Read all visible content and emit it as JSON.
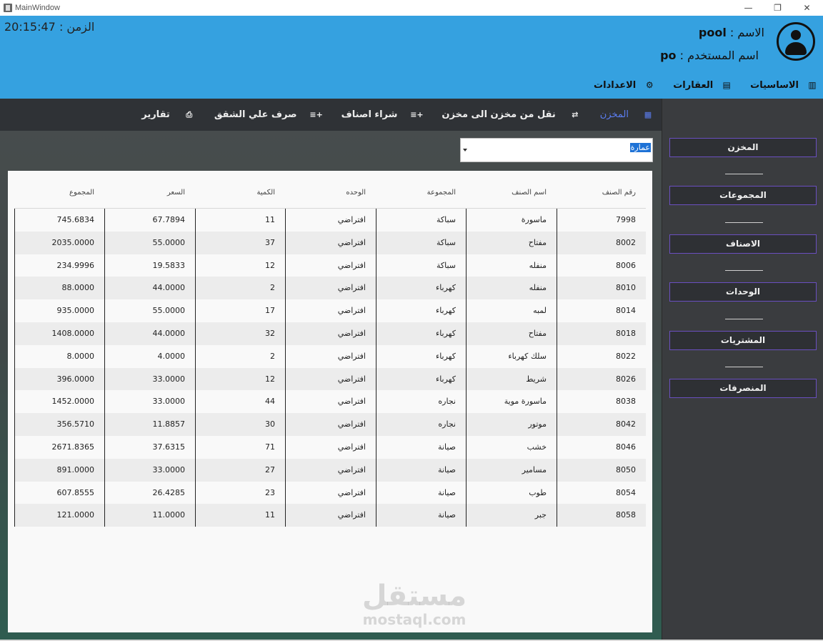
{
  "window": {
    "title": "MainWindow",
    "minimize": "—",
    "restore": "❐",
    "close": "✕"
  },
  "header": {
    "clock": "الزمن : 20:15:47",
    "name_label": "الاسم :",
    "name_value": "pool",
    "login_label": "اسم المستخدم :",
    "login_value": "po"
  },
  "menu": [
    {
      "label": "الاساسيات",
      "icon": "office-building-icon"
    },
    {
      "label": "العقارات",
      "icon": "notebook-icon"
    },
    {
      "label": "الاعدادات",
      "icon": "gear-icon"
    }
  ],
  "toolbar": [
    {
      "label": "المخزن",
      "icon": "calendar-icon",
      "active": true
    },
    {
      "label": "نقل من مخزن الى مخزن",
      "icon": "swap-arrows-icon"
    },
    {
      "label": "شراء اصناف",
      "icon": "add-list-icon"
    },
    {
      "label": "صرف علي الشقق",
      "icon": "add-list-icon"
    },
    {
      "label": "تقارير",
      "icon": "printer-icon"
    }
  ],
  "combo": {
    "value": "عمارة"
  },
  "table": {
    "headers": [
      "رقم الصنف",
      "اسم الصنف",
      "المجموعة",
      "الوحده",
      "الكمية",
      "السعر",
      "المجموع"
    ],
    "rows": [
      [
        "7998",
        "ماسورة",
        "سباكة",
        "افتراضي",
        "11",
        "67.7894",
        "745.6834"
      ],
      [
        "8002",
        "مفتاح",
        "سباكة",
        "افتراضي",
        "37",
        "55.0000",
        "2035.0000"
      ],
      [
        "8006",
        "منفله",
        "سباكة",
        "افتراضي",
        "12",
        "19.5833",
        "234.9996"
      ],
      [
        "8010",
        "منفله",
        "كهرباء",
        "افتراضي",
        "2",
        "44.0000",
        "88.0000"
      ],
      [
        "8014",
        "لمبه",
        "كهرباء",
        "افتراضي",
        "17",
        "55.0000",
        "935.0000"
      ],
      [
        "8018",
        "مفتاح",
        "كهرباء",
        "افتراضي",
        "32",
        "44.0000",
        "1408.0000"
      ],
      [
        "8022",
        "سلك كهرباء",
        "كهرباء",
        "افتراضي",
        "2",
        "4.0000",
        "8.0000"
      ],
      [
        "8026",
        "شريط",
        "كهرباء",
        "افتراضي",
        "12",
        "33.0000",
        "396.0000"
      ],
      [
        "8038",
        "ماسورة موية",
        "نجاره",
        "افتراضي",
        "44",
        "33.0000",
        "1452.0000"
      ],
      [
        "8042",
        "موتور",
        "نجاره",
        "افتراضي",
        "30",
        "11.8857",
        "356.5710"
      ],
      [
        "8046",
        "خشب",
        "صيانة",
        "افتراضي",
        "71",
        "37.6315",
        "2671.8365"
      ],
      [
        "8050",
        "مسامير",
        "صيانة",
        "افتراضي",
        "27",
        "33.0000",
        "891.0000"
      ],
      [
        "8054",
        "طوب",
        "صيانة",
        "افتراضي",
        "23",
        "26.4285",
        "607.8555"
      ],
      [
        "8058",
        "جبر",
        "صيانة",
        "افتراضي",
        "11",
        "11.0000",
        "121.0000"
      ]
    ]
  },
  "sidebar": [
    {
      "label": "المخزن"
    },
    {
      "label": "المجموعات"
    },
    {
      "label": "الاصناف"
    },
    {
      "label": "الوحدات"
    },
    {
      "label": "المشتريات"
    },
    {
      "label": "المنصرفات"
    }
  ],
  "watermark": {
    "ar": "مستقل",
    "en": "mostaql.com"
  }
}
